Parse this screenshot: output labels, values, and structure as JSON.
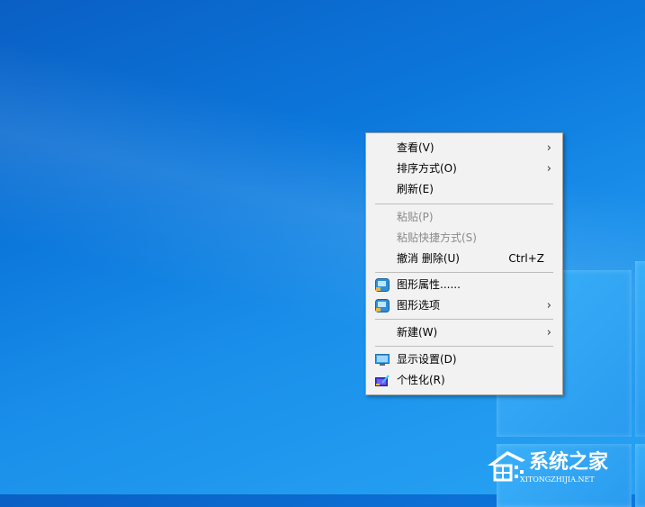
{
  "context_menu": {
    "items": [
      {
        "label": "查看(V)",
        "submenu": true
      },
      {
        "label": "排序方式(O)",
        "submenu": true
      },
      {
        "label": "刷新(E)"
      },
      {
        "label": "粘贴(P)",
        "disabled": true
      },
      {
        "label": "粘贴快捷方式(S)",
        "disabled": true
      },
      {
        "label": "撤消 删除(U)",
        "shortcut": "Ctrl+Z"
      },
      {
        "label": "图形属性......",
        "icon": "graphics-icon"
      },
      {
        "label": "图形选项",
        "icon": "graphics-icon",
        "submenu": true
      },
      {
        "label": "新建(W)",
        "submenu": true
      },
      {
        "label": "显示设置(D)",
        "icon": "display-icon"
      },
      {
        "label": "个性化(R)",
        "icon": "personalize-icon"
      }
    ],
    "arrow": "›"
  },
  "watermark": {
    "title": "系统之家",
    "subtitle": "XITONGZHIJIA.NET"
  }
}
